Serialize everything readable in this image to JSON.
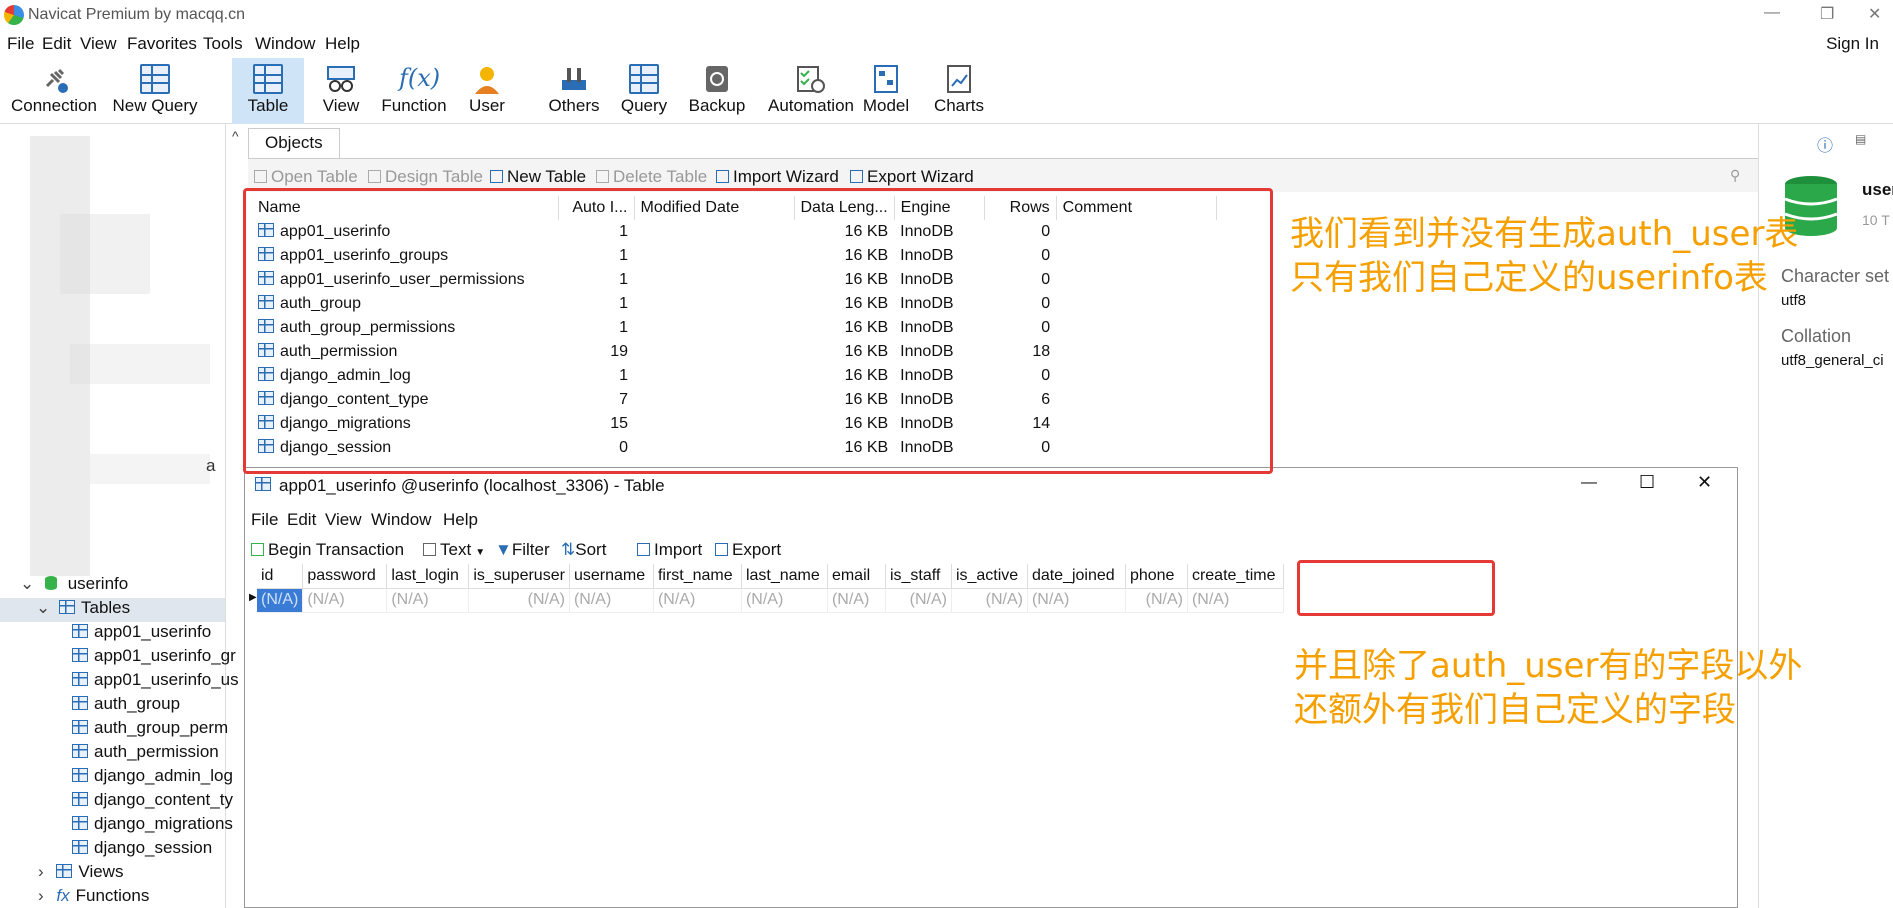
{
  "window": {
    "title": "Navicat Premium by macqq.cn",
    "signin": "Sign In"
  },
  "menu": [
    "File",
    "Edit",
    "View",
    "Favorites",
    "Tools",
    "Window",
    "Help"
  ],
  "toolbar": {
    "items": [
      "Connection",
      "New Query",
      "Table",
      "View",
      "Function",
      "User",
      "Others",
      "Query",
      "Backup",
      "Automation",
      "Model",
      "Charts"
    ],
    "active": "Table"
  },
  "sidebar": {
    "db": "userinfo",
    "tables_label": "Tables",
    "tables": [
      "app01_userinfo",
      "app01_userinfo_gr",
      "app01_userinfo_us",
      "auth_group",
      "auth_group_perm",
      "auth_permission",
      "django_admin_log",
      "django_content_ty",
      "django_migrations",
      "django_session"
    ],
    "views_label": "Views",
    "functions_label": "Functions",
    "stray_char": "a"
  },
  "objects": {
    "tab": "Objects",
    "actions": [
      "Open Table",
      "Design Table",
      "New Table",
      "Delete Table",
      "Import Wizard",
      "Export Wizard"
    ],
    "columns": [
      "Name",
      "Auto I...",
      "Modified Date",
      "Data Leng...",
      "Engine",
      "Rows",
      "Comment"
    ],
    "rows": [
      [
        "app01_userinfo",
        "1",
        "",
        "16 KB",
        "InnoDB",
        "0"
      ],
      [
        "app01_userinfo_groups",
        "1",
        "",
        "16 KB",
        "InnoDB",
        "0"
      ],
      [
        "app01_userinfo_user_permissions",
        "1",
        "",
        "16 KB",
        "InnoDB",
        "0"
      ],
      [
        "auth_group",
        "1",
        "",
        "16 KB",
        "InnoDB",
        "0"
      ],
      [
        "auth_group_permissions",
        "1",
        "",
        "16 KB",
        "InnoDB",
        "0"
      ],
      [
        "auth_permission",
        "19",
        "",
        "16 KB",
        "InnoDB",
        "18"
      ],
      [
        "django_admin_log",
        "1",
        "",
        "16 KB",
        "InnoDB",
        "0"
      ],
      [
        "django_content_type",
        "7",
        "",
        "16 KB",
        "InnoDB",
        "6"
      ],
      [
        "django_migrations",
        "15",
        "",
        "16 KB",
        "InnoDB",
        "14"
      ],
      [
        "django_session",
        "0",
        "",
        "16 KB",
        "InnoDB",
        "0"
      ]
    ]
  },
  "rightpanel": {
    "name": "user",
    "sub": "10 T",
    "charset_label": "Character set",
    "charset": "utf8",
    "collation_label": "Collation",
    "collation": "utf8_general_ci"
  },
  "inner": {
    "title": "app01_userinfo @userinfo (localhost_3306) - Table",
    "menu": [
      "File",
      "Edit",
      "View",
      "Window",
      "Help"
    ],
    "tools": [
      "Begin Transaction",
      "Text",
      "Filter",
      "Sort",
      "Import",
      "Export"
    ],
    "fields": [
      "id",
      "password",
      "last_login",
      "is_superuser",
      "username",
      "first_name",
      "last_name",
      "email",
      "is_staff",
      "is_active",
      "date_joined",
      "phone",
      "create_time"
    ],
    "null_value": "(N/A)"
  },
  "annotations": {
    "note1_line1": "我们看到并没有生成auth_user表",
    "note1_line2": "只有我们自己定义的userinfo表",
    "note2_line1": "并且除了auth_user有的字段以外",
    "note2_line2": "还额外有我们自己定义的字段",
    "color": "#f5a000",
    "box_color": "#e53935"
  }
}
